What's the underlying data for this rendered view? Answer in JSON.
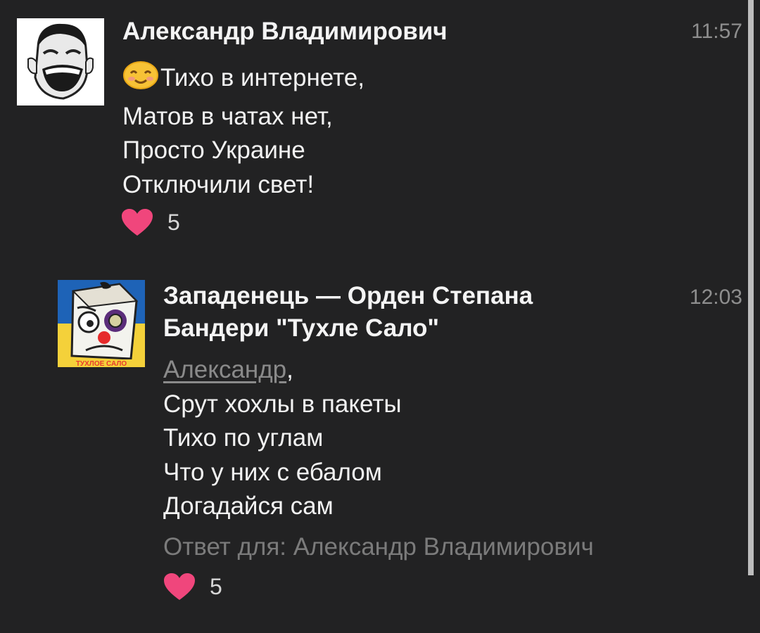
{
  "comments": [
    {
      "author": "Александр Владимирович",
      "time": "11:57",
      "lines": [
        "Тихо в интернете,",
        "Матов в чатах нет,",
        "Просто Украине",
        "Отключили свет!"
      ],
      "likes": "5",
      "icons": {
        "avatar": "troll-face-avatar",
        "emoji": "smiling-emoji-icon",
        "like": "heart-icon"
      }
    },
    {
      "author_line1": "Западенець — Орден Степана",
      "author_line2": "Бандери \"Тухле Сало\"",
      "time": "12:03",
      "mention": "Александр",
      "mention_suffix": ",",
      "lines": [
        "Срут хохлы в пакеты",
        "Тихо по углам",
        "Что у них с ебалом",
        "Догадайся сам"
      ],
      "reply_to": "Ответ для: Александр Владимирович",
      "likes": "5",
      "avatar_caption": "ТУХЛОЕ САЛО",
      "icons": {
        "avatar": "salo-cartoon-avatar",
        "like": "heart-icon"
      }
    }
  ],
  "colors": {
    "background": "#222223",
    "text": "#f2f2f2",
    "muted": "#8e8e8e",
    "like": "#f0467c",
    "flag_blue": "#1e63b7",
    "flag_yellow": "#f4d13a"
  }
}
